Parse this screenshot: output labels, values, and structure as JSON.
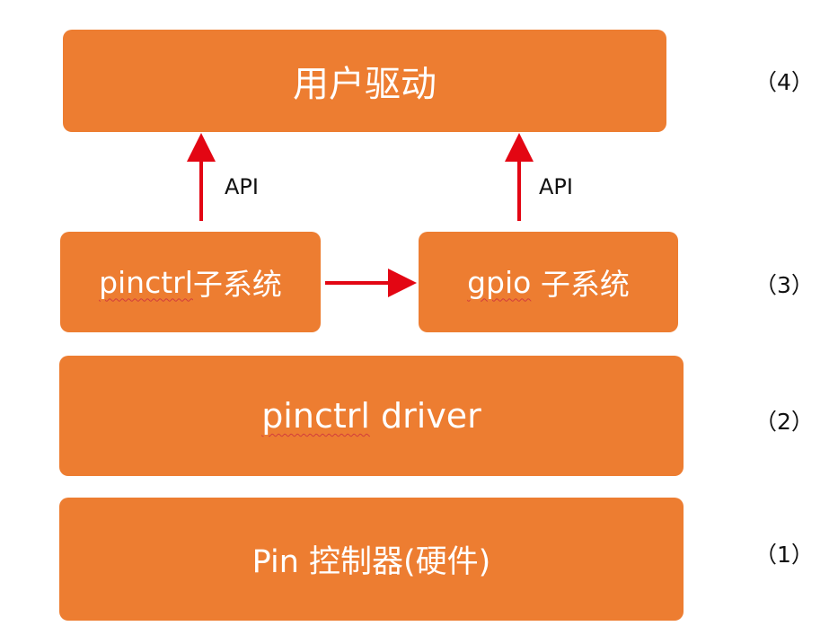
{
  "diagram": {
    "boxes": {
      "user_driver": "用户驱动",
      "pinctrl_subsystem": {
        "prefix": "pinctrl",
        "suffix": "子系统"
      },
      "gpio_subsystem": {
        "prefix": "gpio",
        "suffix": " 子系统"
      },
      "pinctrl_driver": {
        "prefix": "pinctrl",
        "suffix": " driver"
      },
      "pin_controller": "Pin 控制器(硬件)"
    },
    "edges": {
      "left_api_label": "API",
      "right_api_label": "API"
    },
    "levels": {
      "level4": "（4）",
      "level3": "（3）",
      "level2": "（2）",
      "level1": "（1）"
    },
    "colors": {
      "box_fill": "#ED7D31",
      "box_text": "#FFFFFF",
      "arrow": "#E30613"
    }
  }
}
